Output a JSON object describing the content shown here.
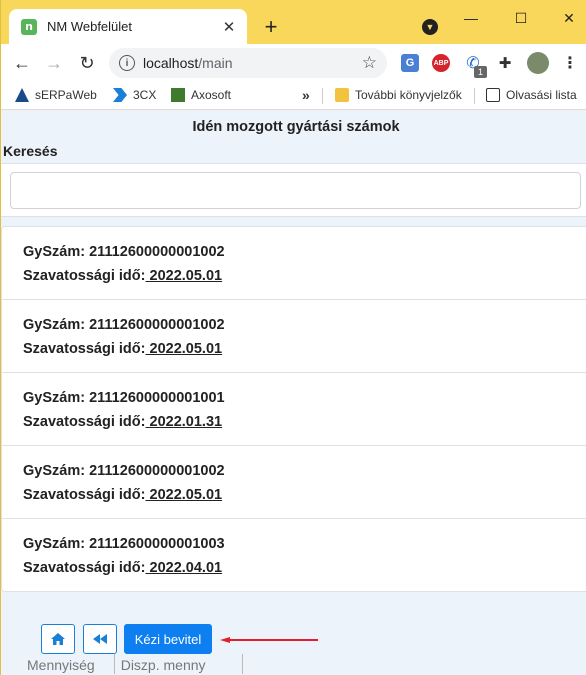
{
  "browser": {
    "tab_title": "NM Webfelület",
    "tab_favicon_text": "n",
    "tab_close": "✕",
    "new_tab": "+",
    "url_host": "localhost",
    "url_path": "/main",
    "window_controls": [
      "—",
      "☐",
      "✕"
    ]
  },
  "bookmarks": {
    "items": [
      "sERPaWeb",
      "3CX",
      "Axosoft"
    ],
    "more": "»",
    "other": "További könyvjelzők",
    "reading_list": "Olvasási lista"
  },
  "extensions": {
    "phone_badge": "1",
    "abp_text": "ABP",
    "translate_text": "G"
  },
  "page": {
    "title": "Idén mozgott gyártási számok",
    "search_label": "Keresés",
    "search_value": "",
    "item_label_serial": "GySzám:",
    "item_label_warranty": "Szavatossági idő:",
    "items": [
      {
        "serial": "21112600000001002",
        "warranty": "2022.05.01"
      },
      {
        "serial": "21112600000001002",
        "warranty": "2022.05.01"
      },
      {
        "serial": "21112600000001001",
        "warranty": "2022.01.31"
      },
      {
        "serial": "21112600000001002",
        "warranty": "2022.05.01"
      },
      {
        "serial": "21112600000001003",
        "warranty": "2022.04.01"
      }
    ],
    "manual_entry_button": "Kézi bevitel",
    "footer_under": [
      "Mennyiség",
      "Diszp. menny"
    ]
  },
  "colors": {
    "tabstrip": "#f9d75a",
    "primary": "#0d7ff0",
    "arrow": "#e0202a",
    "page_bg": "#edf3fa"
  }
}
